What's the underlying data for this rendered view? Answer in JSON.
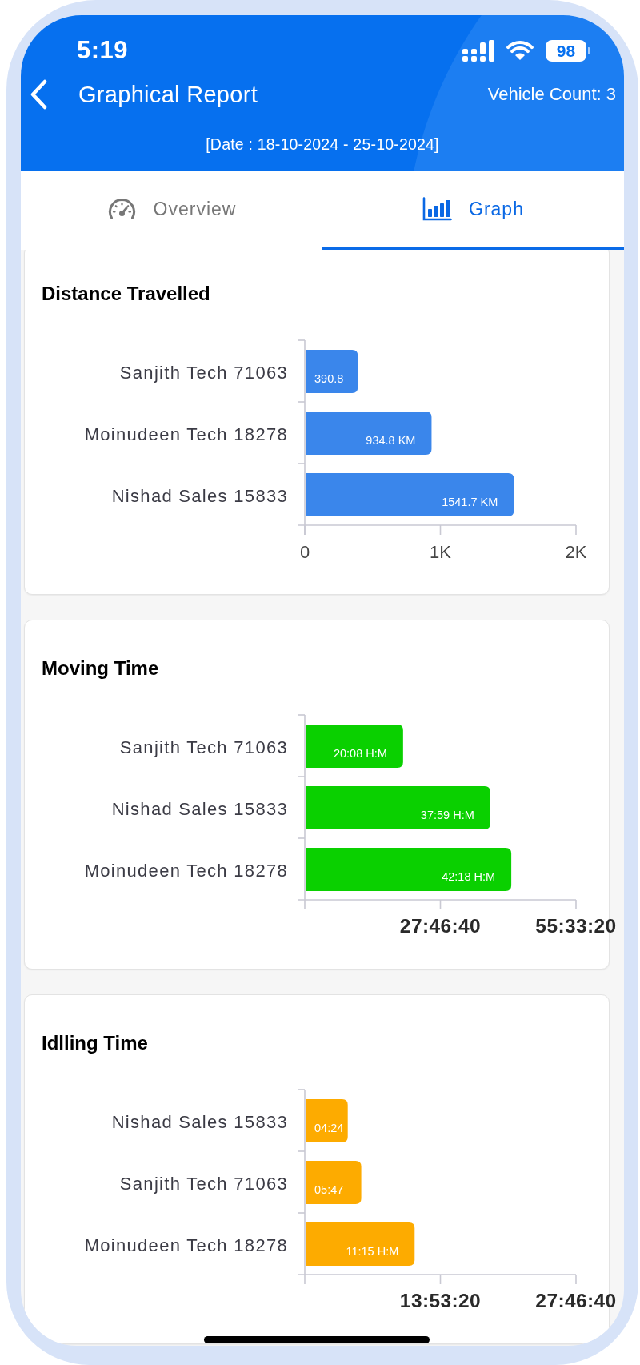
{
  "status_bar": {
    "time": "5:19",
    "battery": "98"
  },
  "header": {
    "title": "Graphical Report",
    "vehicle_count": "Vehicle Count: 3",
    "date_range": "[Date : 18-10-2024 - 25-10-2024]"
  },
  "tabs": [
    {
      "label": "Overview",
      "selected": false
    },
    {
      "label": "Graph",
      "selected": true
    }
  ],
  "panels": [
    {
      "kind": "distance",
      "chart_data": {
        "type": "bar",
        "orientation": "horizontal",
        "title": "Distance Travelled",
        "categories": [
          "Sanjith Tech 71063",
          "Moinudeen Tech 18278",
          "Nishad Sales 15833"
        ],
        "series": [
          {
            "color": "#3a86eb",
            "values": [
              390.8,
              934.8,
              1541.7
            ]
          }
        ],
        "xlim": [
          0,
          2000
        ],
        "xticks": [
          {
            "value": 0,
            "label": "0"
          },
          {
            "value": 1000,
            "label": "1K"
          },
          {
            "value": 2000,
            "label": "2K"
          }
        ],
        "value_labels": [
          "390.8",
          "934.8 KM",
          "1541.7 KM"
        ]
      }
    },
    {
      "kind": "duration",
      "chart_data": {
        "type": "bar",
        "orientation": "horizontal",
        "title": "Moving Time",
        "categories": [
          "Sanjith Tech 71063",
          "Nishad Sales 15833",
          "Moinudeen Tech 18278"
        ],
        "series": [
          {
            "color": "#0ad000",
            "values": [
              72480,
              136740,
              152280
            ]
          }
        ],
        "xlim": [
          0,
          200000
        ],
        "xticks": [
          {
            "value": 100000,
            "label": "27:46:40"
          },
          {
            "value": 200000,
            "label": "55:33:20"
          }
        ],
        "value_labels": [
          "20:08 H:M",
          "37:59 H:M",
          "42:18 H:M"
        ]
      }
    },
    {
      "kind": "duration",
      "chart_data": {
        "type": "bar",
        "orientation": "horizontal",
        "title": "Idlling Time",
        "categories": [
          "Nishad Sales 15833",
          "Sanjith Tech 71063",
          "Moinudeen Tech 18278"
        ],
        "series": [
          {
            "color": "#fdab00",
            "values": [
              15840,
              20820,
              40500
            ]
          }
        ],
        "xlim": [
          0,
          100000
        ],
        "xticks": [
          {
            "value": 50000,
            "label": "13:53:20"
          },
          {
            "value": 100000,
            "label": "27:46:40"
          }
        ],
        "value_labels": [
          "04:24",
          "05:47",
          "11:15 H:M"
        ]
      }
    }
  ]
}
